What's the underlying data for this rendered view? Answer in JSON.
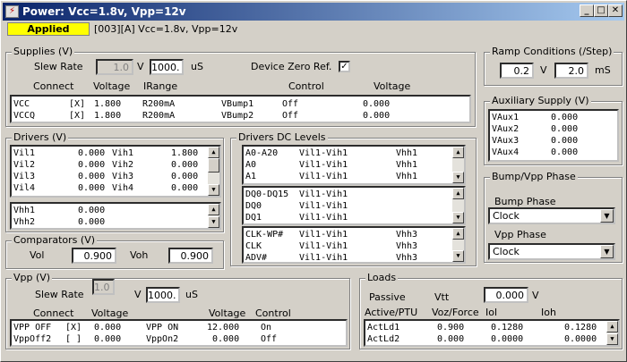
{
  "window": {
    "title": "Power: Vcc=1.8v, Vpp=12v",
    "icon": "power-icon"
  },
  "status": {
    "badge": "Applied",
    "text": "[003][A] Vcc=1.8v, Vpp=12v",
    "badge_color": "#ffff00"
  },
  "supplies": {
    "title": "Supplies (V)",
    "slew_rate_label": "Slew Rate",
    "slew_value": "1.0",
    "slew_unit": "V",
    "time_value": "1000.",
    "time_unit": "uS",
    "device_zero_label": "Device Zero Ref.",
    "device_zero_checked": "✓",
    "headers": {
      "connect": "Connect",
      "voltage": "Voltage",
      "irange": "IRange",
      "control": "Control",
      "voltage2": "Voltage"
    },
    "rows": [
      {
        "name": "VCC",
        "conn": "[X]",
        "volt": "1.800",
        "irange": "R200mA",
        "bump": "VBump1",
        "ctrl": "Off",
        "cv": "0.000"
      },
      {
        "name": "VCCQ",
        "conn": "[X]",
        "volt": "1.800",
        "irange": "R200mA",
        "bump": "VBump2",
        "ctrl": "Off",
        "cv": "0.000"
      }
    ]
  },
  "ramp": {
    "title": "Ramp Conditions (/Step)",
    "v_value": "0.2",
    "v_unit": "V",
    "t_value": "2.0",
    "t_unit": "mS"
  },
  "aux": {
    "title": "Auxiliary Supply (V)",
    "rows": [
      {
        "name": "VAux1",
        "val": "0.000"
      },
      {
        "name": "VAux2",
        "val": "0.000"
      },
      {
        "name": "VAux3",
        "val": "0.000"
      },
      {
        "name": "VAux4",
        "val": "0.000"
      }
    ]
  },
  "drivers": {
    "title": "Drivers (V)",
    "rows": [
      {
        "a": "Vil1",
        "av": "0.000",
        "b": "Vih1",
        "bv": "1.800"
      },
      {
        "a": "Vil2",
        "av": "0.000",
        "b": "Vih2",
        "bv": "0.000"
      },
      {
        "a": "Vil3",
        "av": "0.000",
        "b": "Vih3",
        "bv": "0.000"
      },
      {
        "a": "Vil4",
        "av": "0.000",
        "b": "Vih4",
        "bv": "0.000"
      }
    ],
    "vhh": [
      {
        "a": "Vhh1",
        "av": "0.000"
      },
      {
        "a": "Vhh2",
        "av": "0.000"
      }
    ]
  },
  "drivers_dc": {
    "title": "Drivers DC Levels",
    "list1": [
      {
        "pin": "A0-A20",
        "lvl": "Vil1-Vih1",
        "hh": "Vhh1"
      },
      {
        "pin": "A0",
        "lvl": "Vil1-Vih1",
        "hh": "Vhh1"
      },
      {
        "pin": "A1",
        "lvl": "Vil1-Vih1",
        "hh": "Vhh1"
      }
    ],
    "list2": [
      {
        "pin": "DQ0-DQ15",
        "lvl": "Vil1-Vih1",
        "hh": ""
      },
      {
        "pin": "DQ0",
        "lvl": "Vil1-Vih1",
        "hh": ""
      },
      {
        "pin": "DQ1",
        "lvl": "Vil1-Vih1",
        "hh": ""
      }
    ],
    "list3": [
      {
        "pin": "CLK-WP#",
        "lvl": "Vil1-Vih1",
        "hh": "Vhh3"
      },
      {
        "pin": "CLK",
        "lvl": "Vil1-Vih1",
        "hh": "Vhh3"
      },
      {
        "pin": "ADV#",
        "lvl": "Vil1-Vih1",
        "hh": "Vhh3"
      }
    ]
  },
  "comparators": {
    "title": "Comparators (V)",
    "vol_label": "Vol",
    "vol_value": "0.900",
    "voh_label": "Voh",
    "voh_value": "0.900"
  },
  "bump": {
    "title": "Bump/Vpp Phase",
    "bump_label": "Bump Phase",
    "bump_value": "Clock",
    "vpp_label": "Vpp Phase",
    "vpp_value": "Clock"
  },
  "vpp": {
    "title": "Vpp (V)",
    "slew_rate_label": "Slew Rate",
    "slew_value": "1.0",
    "slew_unit": "V",
    "time_value": "1000.",
    "time_unit": "uS",
    "headers": {
      "connect": "Connect",
      "voltage": "Voltage",
      "voltage2": "Voltage",
      "control": "Control"
    },
    "rows": [
      {
        "name": "VPP OFF",
        "conn": "[X]",
        "volt": "0.000",
        "on": "VPP ON",
        "v2": "12.000",
        "ctrl": "On"
      },
      {
        "name": "VppOff2",
        "conn": "[ ]",
        "volt": "0.000",
        "on": "VppOn2",
        "v2": "0.000",
        "ctrl": "Off"
      }
    ]
  },
  "loads": {
    "title": "Loads",
    "passive_label": "Passive",
    "vtt_label": "Vtt",
    "vtt_value": "0.000",
    "vtt_unit": "V",
    "headers": {
      "active": "Active/PTU",
      "voz": "Voz/Force",
      "iol": "Iol",
      "ioh": "Ioh"
    },
    "rows": [
      {
        "name": "ActLd1",
        "voz": "0.900",
        "iol": "0.1280",
        "ioh": "0.1280"
      },
      {
        "name": "ActLd2",
        "voz": "0.000",
        "iol": "0.0000",
        "ioh": "0.0000"
      }
    ]
  }
}
